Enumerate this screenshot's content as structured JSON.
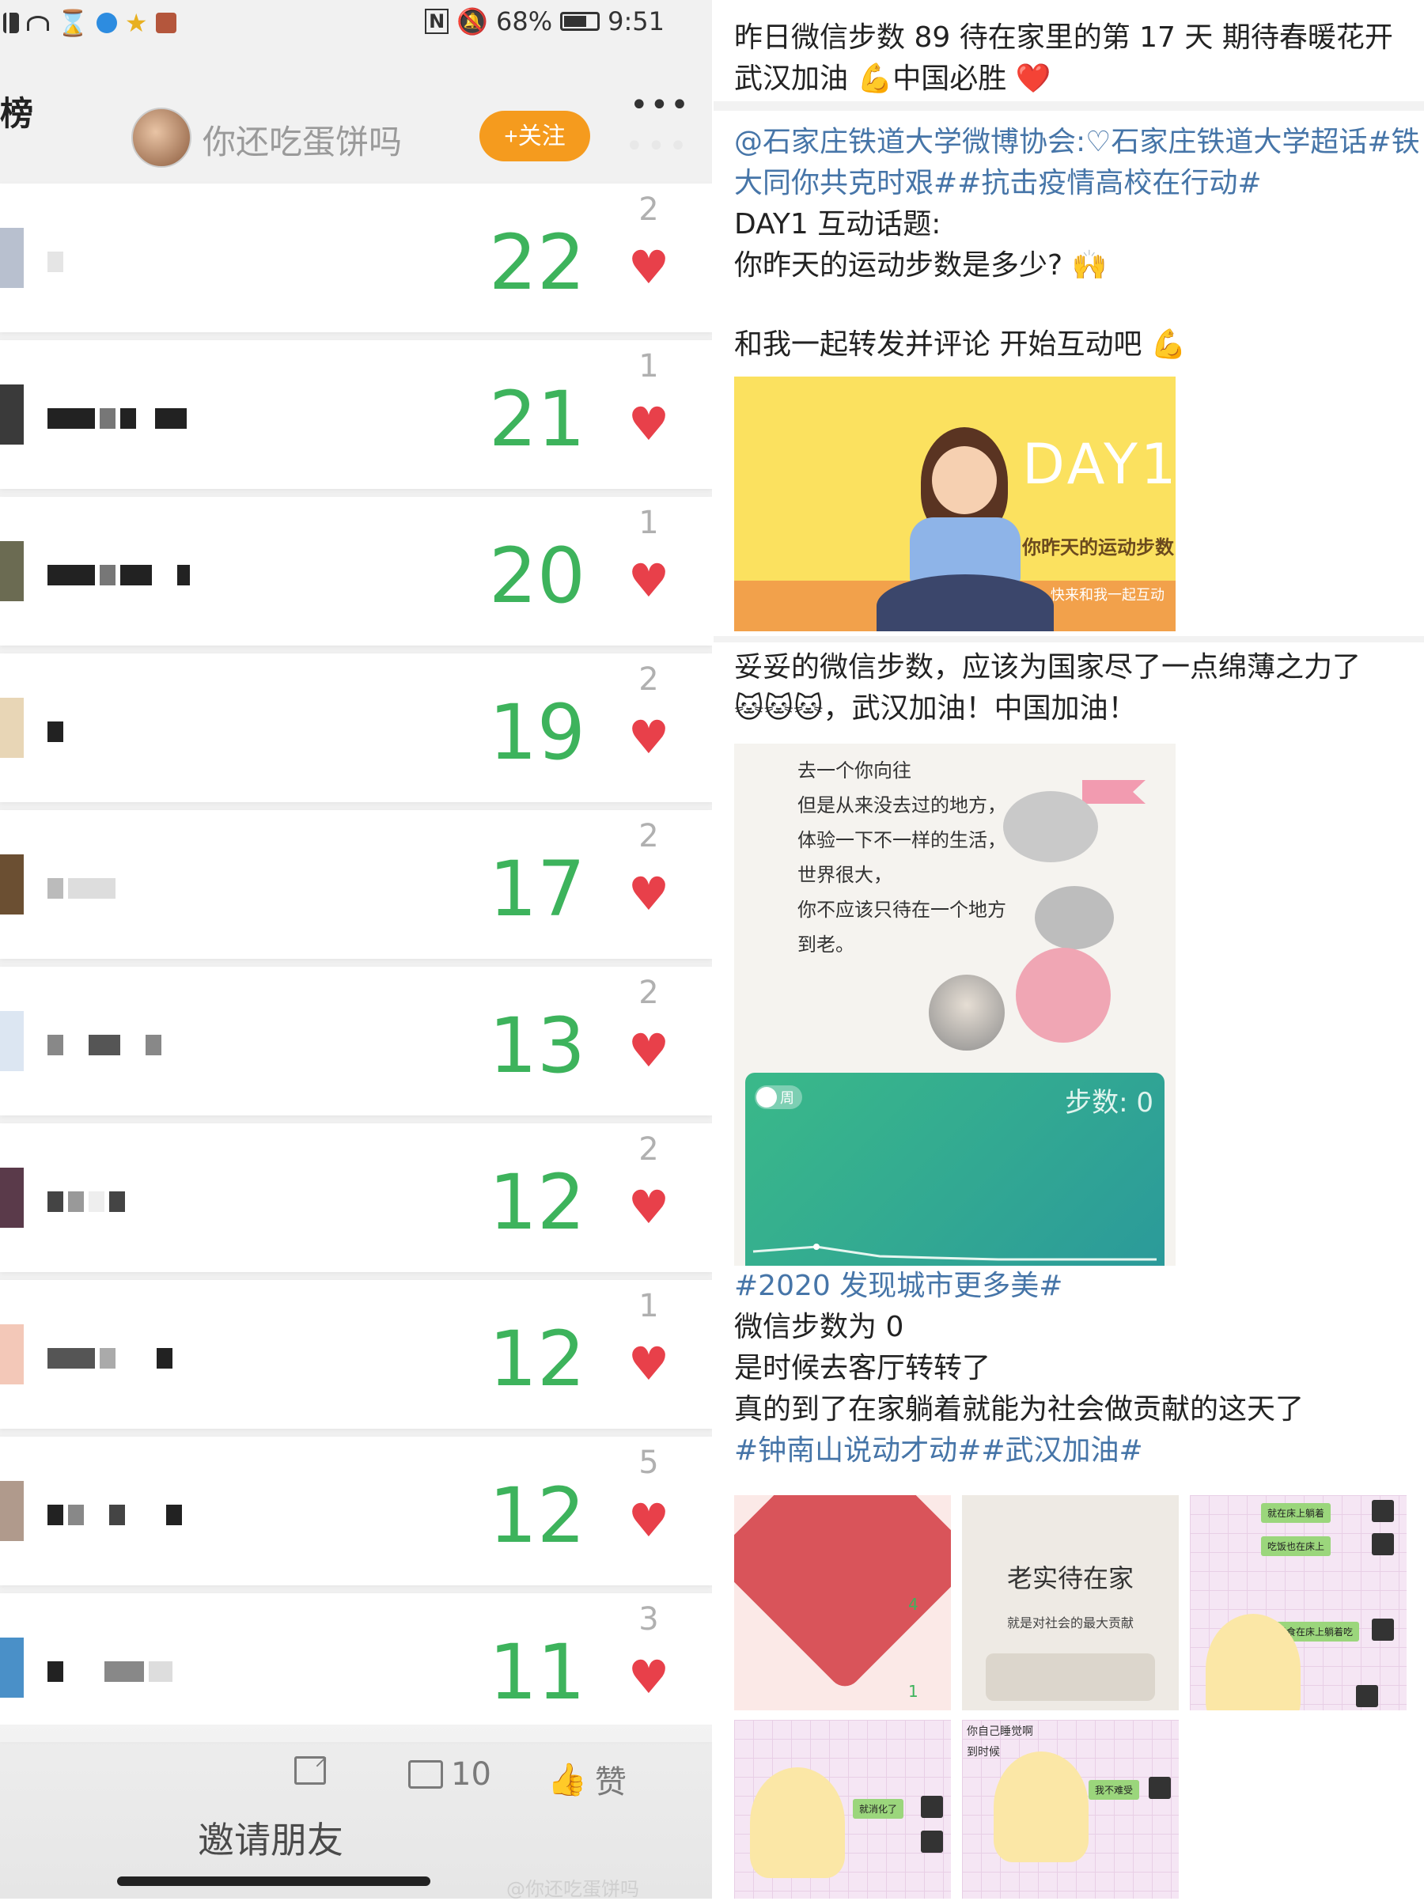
{
  "status_bar": {
    "battery": "68%",
    "time": "9:51",
    "nfc": "N",
    "mute_icon": "bell-off-icon"
  },
  "rank_header": {
    "title": "榜",
    "username": "你还吃蛋饼吗",
    "follow_label": "+关注",
    "more_icon": "•••"
  },
  "ranking": [
    {
      "steps": "22",
      "likes": "2"
    },
    {
      "steps": "21",
      "likes": "1"
    },
    {
      "steps": "20",
      "likes": "1"
    },
    {
      "steps": "19",
      "likes": "2"
    },
    {
      "steps": "17",
      "likes": "2"
    },
    {
      "steps": "13",
      "likes": "2"
    },
    {
      "steps": "12",
      "likes": "2"
    },
    {
      "steps": "12",
      "likes": "1"
    },
    {
      "steps": "12",
      "likes": "5"
    },
    {
      "steps": "11",
      "likes": "3"
    }
  ],
  "bottom_bar": {
    "share_icon": "share-icon",
    "comment_count": "10",
    "like_label": "赞",
    "invite_label": "邀请朋友"
  },
  "watermark": "@你还吃蛋饼吗",
  "posts": {
    "p1_line1": "昨日微信步数 89 待在家里的第 17 天 期待春暖花开",
    "p1_line2": "武汉加油 💪中国必胜 ❤️",
    "p2_line1": "@石家庄铁道大学微博协会:♡石家庄铁道大学超话#铁",
    "p2_line2": "大同你共克时艰##抗击疫情高校在行动#",
    "p2_line3": "DAY1 互动话题:",
    "p2_line4": "你昨天的运动步数是多少? 🙌",
    "p2_line5": "和我一起转发并评论  开始互动吧 💪",
    "day1_label": "DAY1",
    "day1_sub": "你昨天的运动步数",
    "day1_sub2": "快来和我一起互动",
    "p3_line1": "妥妥的微信步数，应该为国家尽了一点绵薄之力了",
    "p3_line2": "🐱🐱🐱，武汉加油！中国加油！",
    "poem": "去一个你向往\n但是从来没去过的地方，\n体验一下不一样的生活，\n世界很大，\n你不应该只待在一个地方\n到老。",
    "week_toggle": "周",
    "steps_display": "步数: 0",
    "p4_tag": "#2020 发现城市更多美#",
    "p4_line1": "微信步数为 0",
    "p4_line2": "是时候去客厅转转了",
    "p4_line3": "真的到了在家躺着就能为社会做贡献的这天了",
    "p4_tags2": "#钟南山说动才动##武汉加油#",
    "g2_title": "老实待在家",
    "g2_sub": "就是对社会的最大贡献",
    "g1_num1": "4",
    "g1_num2": "1",
    "g3_chat1": "就在床上躺着",
    "g3_chat2": "吃饭也在床上",
    "g3_chat3": "吃零食在床上躺着吃",
    "g4_chat1": "就消化了",
    "g5_top1": "你自己睡觉啊",
    "g5_top2": "到时候",
    "g5_chat1": "我不难受"
  },
  "colors": {
    "steps_green": "#3db35c",
    "heart_red": "#e8404a",
    "follow_orange": "#f59b1e",
    "link_blue": "#4675a8"
  }
}
